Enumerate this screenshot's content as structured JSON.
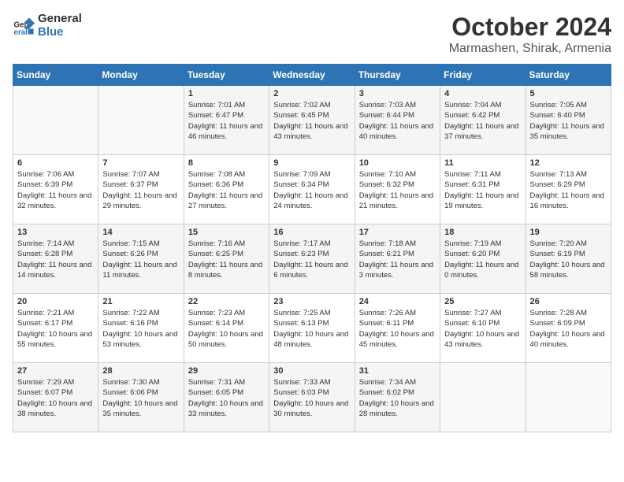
{
  "header": {
    "logo_general": "General",
    "logo_blue": "Blue",
    "month_year": "October 2024",
    "location": "Marmashen, Shirak, Armenia"
  },
  "days_of_week": [
    "Sunday",
    "Monday",
    "Tuesday",
    "Wednesday",
    "Thursday",
    "Friday",
    "Saturday"
  ],
  "weeks": [
    [
      {
        "day": "",
        "sunrise": "",
        "sunset": "",
        "daylight": ""
      },
      {
        "day": "",
        "sunrise": "",
        "sunset": "",
        "daylight": ""
      },
      {
        "day": "1",
        "sunrise": "Sunrise: 7:01 AM",
        "sunset": "Sunset: 6:47 PM",
        "daylight": "Daylight: 11 hours and 46 minutes."
      },
      {
        "day": "2",
        "sunrise": "Sunrise: 7:02 AM",
        "sunset": "Sunset: 6:45 PM",
        "daylight": "Daylight: 11 hours and 43 minutes."
      },
      {
        "day": "3",
        "sunrise": "Sunrise: 7:03 AM",
        "sunset": "Sunset: 6:44 PM",
        "daylight": "Daylight: 11 hours and 40 minutes."
      },
      {
        "day": "4",
        "sunrise": "Sunrise: 7:04 AM",
        "sunset": "Sunset: 6:42 PM",
        "daylight": "Daylight: 11 hours and 37 minutes."
      },
      {
        "day": "5",
        "sunrise": "Sunrise: 7:05 AM",
        "sunset": "Sunset: 6:40 PM",
        "daylight": "Daylight: 11 hours and 35 minutes."
      }
    ],
    [
      {
        "day": "6",
        "sunrise": "Sunrise: 7:06 AM",
        "sunset": "Sunset: 6:39 PM",
        "daylight": "Daylight: 11 hours and 32 minutes."
      },
      {
        "day": "7",
        "sunrise": "Sunrise: 7:07 AM",
        "sunset": "Sunset: 6:37 PM",
        "daylight": "Daylight: 11 hours and 29 minutes."
      },
      {
        "day": "8",
        "sunrise": "Sunrise: 7:08 AM",
        "sunset": "Sunset: 6:36 PM",
        "daylight": "Daylight: 11 hours and 27 minutes."
      },
      {
        "day": "9",
        "sunrise": "Sunrise: 7:09 AM",
        "sunset": "Sunset: 6:34 PM",
        "daylight": "Daylight: 11 hours and 24 minutes."
      },
      {
        "day": "10",
        "sunrise": "Sunrise: 7:10 AM",
        "sunset": "Sunset: 6:32 PM",
        "daylight": "Daylight: 11 hours and 21 minutes."
      },
      {
        "day": "11",
        "sunrise": "Sunrise: 7:11 AM",
        "sunset": "Sunset: 6:31 PM",
        "daylight": "Daylight: 11 hours and 19 minutes."
      },
      {
        "day": "12",
        "sunrise": "Sunrise: 7:13 AM",
        "sunset": "Sunset: 6:29 PM",
        "daylight": "Daylight: 11 hours and 16 minutes."
      }
    ],
    [
      {
        "day": "13",
        "sunrise": "Sunrise: 7:14 AM",
        "sunset": "Sunset: 6:28 PM",
        "daylight": "Daylight: 11 hours and 14 minutes."
      },
      {
        "day": "14",
        "sunrise": "Sunrise: 7:15 AM",
        "sunset": "Sunset: 6:26 PM",
        "daylight": "Daylight: 11 hours and 11 minutes."
      },
      {
        "day": "15",
        "sunrise": "Sunrise: 7:16 AM",
        "sunset": "Sunset: 6:25 PM",
        "daylight": "Daylight: 11 hours and 8 minutes."
      },
      {
        "day": "16",
        "sunrise": "Sunrise: 7:17 AM",
        "sunset": "Sunset: 6:23 PM",
        "daylight": "Daylight: 11 hours and 6 minutes."
      },
      {
        "day": "17",
        "sunrise": "Sunrise: 7:18 AM",
        "sunset": "Sunset: 6:21 PM",
        "daylight": "Daylight: 11 hours and 3 minutes."
      },
      {
        "day": "18",
        "sunrise": "Sunrise: 7:19 AM",
        "sunset": "Sunset: 6:20 PM",
        "daylight": "Daylight: 11 hours and 0 minutes."
      },
      {
        "day": "19",
        "sunrise": "Sunrise: 7:20 AM",
        "sunset": "Sunset: 6:19 PM",
        "daylight": "Daylight: 10 hours and 58 minutes."
      }
    ],
    [
      {
        "day": "20",
        "sunrise": "Sunrise: 7:21 AM",
        "sunset": "Sunset: 6:17 PM",
        "daylight": "Daylight: 10 hours and 55 minutes."
      },
      {
        "day": "21",
        "sunrise": "Sunrise: 7:22 AM",
        "sunset": "Sunset: 6:16 PM",
        "daylight": "Daylight: 10 hours and 53 minutes."
      },
      {
        "day": "22",
        "sunrise": "Sunrise: 7:23 AM",
        "sunset": "Sunset: 6:14 PM",
        "daylight": "Daylight: 10 hours and 50 minutes."
      },
      {
        "day": "23",
        "sunrise": "Sunrise: 7:25 AM",
        "sunset": "Sunset: 6:13 PM",
        "daylight": "Daylight: 10 hours and 48 minutes."
      },
      {
        "day": "24",
        "sunrise": "Sunrise: 7:26 AM",
        "sunset": "Sunset: 6:11 PM",
        "daylight": "Daylight: 10 hours and 45 minutes."
      },
      {
        "day": "25",
        "sunrise": "Sunrise: 7:27 AM",
        "sunset": "Sunset: 6:10 PM",
        "daylight": "Daylight: 10 hours and 43 minutes."
      },
      {
        "day": "26",
        "sunrise": "Sunrise: 7:28 AM",
        "sunset": "Sunset: 6:09 PM",
        "daylight": "Daylight: 10 hours and 40 minutes."
      }
    ],
    [
      {
        "day": "27",
        "sunrise": "Sunrise: 7:29 AM",
        "sunset": "Sunset: 6:07 PM",
        "daylight": "Daylight: 10 hours and 38 minutes."
      },
      {
        "day": "28",
        "sunrise": "Sunrise: 7:30 AM",
        "sunset": "Sunset: 6:06 PM",
        "daylight": "Daylight: 10 hours and 35 minutes."
      },
      {
        "day": "29",
        "sunrise": "Sunrise: 7:31 AM",
        "sunset": "Sunset: 6:05 PM",
        "daylight": "Daylight: 10 hours and 33 minutes."
      },
      {
        "day": "30",
        "sunrise": "Sunrise: 7:33 AM",
        "sunset": "Sunset: 6:03 PM",
        "daylight": "Daylight: 10 hours and 30 minutes."
      },
      {
        "day": "31",
        "sunrise": "Sunrise: 7:34 AM",
        "sunset": "Sunset: 6:02 PM",
        "daylight": "Daylight: 10 hours and 28 minutes."
      },
      {
        "day": "",
        "sunrise": "",
        "sunset": "",
        "daylight": ""
      },
      {
        "day": "",
        "sunrise": "",
        "sunset": "",
        "daylight": ""
      }
    ]
  ]
}
